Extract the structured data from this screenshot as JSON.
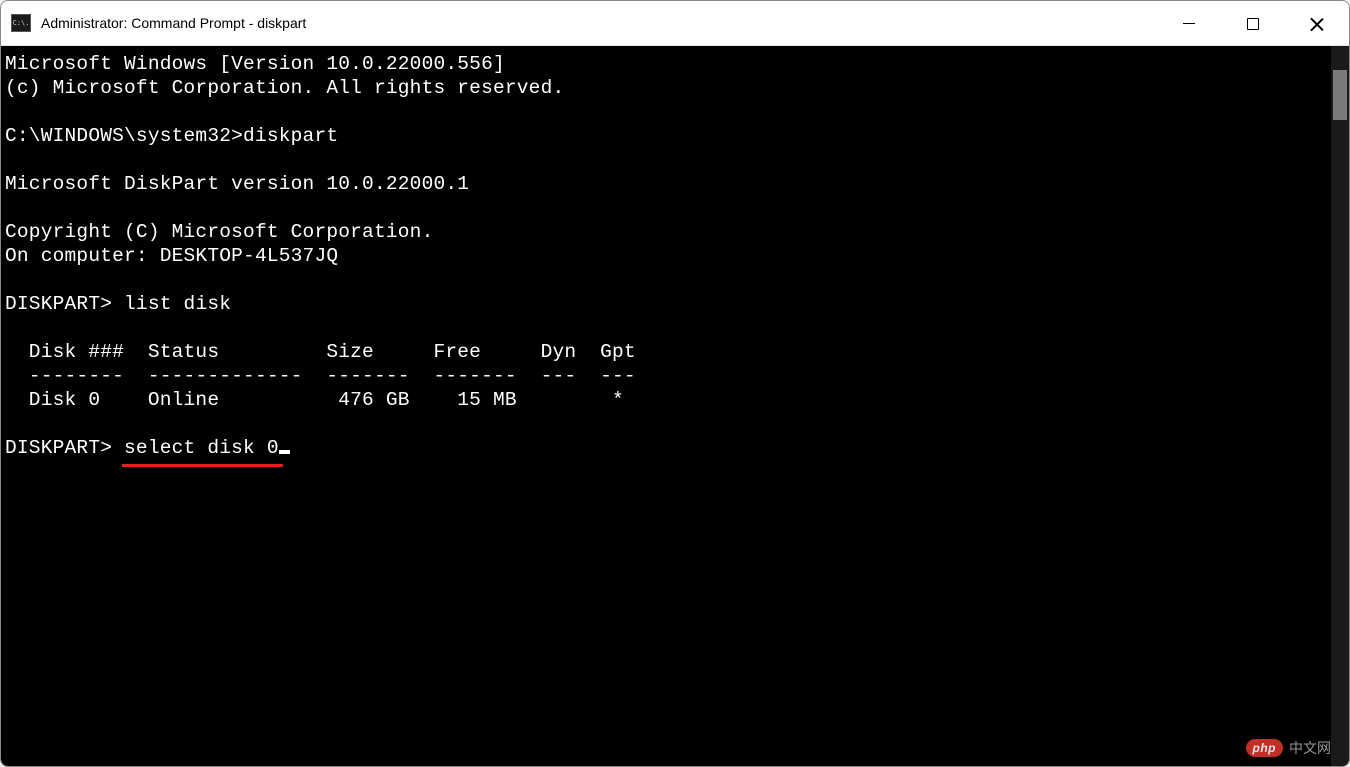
{
  "window": {
    "title": "Administrator: Command Prompt - diskpart",
    "app_icon_text": "C:\\."
  },
  "terminal": {
    "lines": {
      "l0": "Microsoft Windows [Version 10.0.22000.556]",
      "l1": "(c) Microsoft Corporation. All rights reserved.",
      "l2": "",
      "l3_prompt": "C:\\WINDOWS\\system32>",
      "l3_cmd": "diskpart",
      "l4": "",
      "l5": "Microsoft DiskPart version 10.0.22000.1",
      "l6": "",
      "l7": "Copyright (C) Microsoft Corporation.",
      "l8": "On computer: DESKTOP-4L537JQ",
      "l9": "",
      "l10_prompt": "DISKPART> ",
      "l10_cmd": "list disk",
      "l11": "",
      "table_header": "  Disk ###  Status         Size     Free     Dyn  Gpt",
      "table_divider": "  --------  -------------  -------  -------  ---  ---",
      "table_row0": "  Disk 0    Online          476 GB    15 MB        *",
      "l15": "",
      "l16_prompt": "DISKPART> ",
      "l16_cmd": "select disk 0"
    }
  },
  "watermark": {
    "badge": "php",
    "text": "中文网"
  }
}
